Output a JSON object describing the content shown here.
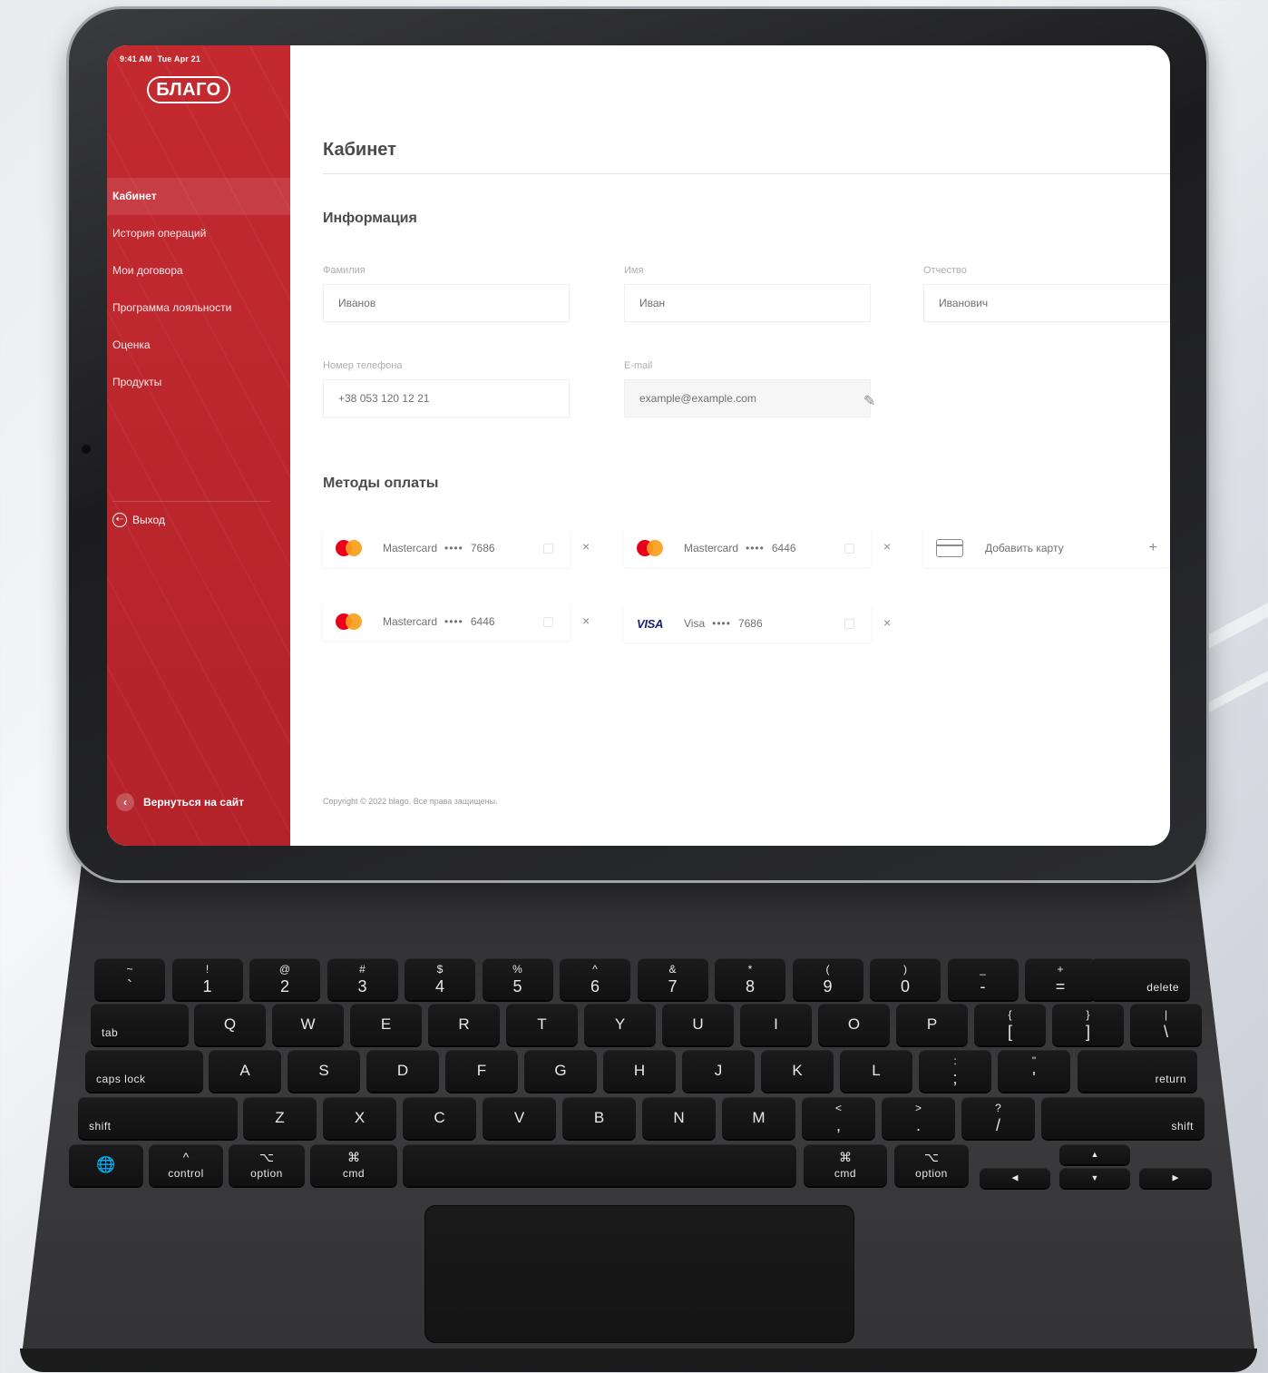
{
  "status_bar": {
    "time": "9:41 AM",
    "date": "Tue Apr 21"
  },
  "sidebar": {
    "logo": "БЛАГО",
    "items": [
      {
        "label": "Кабинет"
      },
      {
        "label": "История операций"
      },
      {
        "label": "Мои договора"
      },
      {
        "label": "Программа лояльности"
      },
      {
        "label": "Оценка"
      },
      {
        "label": "Продукты"
      }
    ],
    "logout_label": "Выход",
    "back_label": "Вернуться на сайт"
  },
  "main": {
    "title": "Кабинет",
    "info_title": "Информация",
    "fields": {
      "last_name": {
        "label": "Фамилия",
        "value": "Иванов"
      },
      "first_name": {
        "label": "Имя",
        "value": "Иван"
      },
      "patronymic": {
        "label": "Отчество",
        "value": "Иванович"
      },
      "phone": {
        "label": "Номер телефона",
        "value": "+38 053 120 12 21"
      },
      "email": {
        "label": "E-mail",
        "value": "example@example.com"
      }
    },
    "payment_title": "Методы оплаты",
    "cards": [
      {
        "brand": "Mastercard",
        "dots": "••••",
        "last4": "7686"
      },
      {
        "brand": "Mastercard",
        "dots": "••••",
        "last4": "6446"
      },
      {
        "brand": "Mastercard",
        "dots": "••••",
        "last4": "6446"
      },
      {
        "brand": "Visa",
        "logo": "VISA",
        "dots": "••••",
        "last4": "7686"
      }
    ],
    "add_card_label": "Добавить карту",
    "remove_symbol": "×",
    "add_symbol": "+",
    "copyright": "Copyright © 2022 blago. Все права защищены."
  },
  "keyboard": {
    "number_row": [
      {
        "top": "~",
        "bot": "`"
      },
      {
        "top": "!",
        "bot": "1"
      },
      {
        "top": "@",
        "bot": "2"
      },
      {
        "top": "#",
        "bot": "3"
      },
      {
        "top": "$",
        "bot": "4"
      },
      {
        "top": "%",
        "bot": "5"
      },
      {
        "top": "^",
        "bot": "6"
      },
      {
        "top": "&",
        "bot": "7"
      },
      {
        "top": "*",
        "bot": "8"
      },
      {
        "top": "(",
        "bot": "9"
      },
      {
        "top": ")",
        "bot": "0"
      },
      {
        "top": "_",
        "bot": "-"
      },
      {
        "top": "+",
        "bot": "="
      }
    ],
    "delete": "delete",
    "tab": "tab",
    "row_q": [
      "Q",
      "W",
      "E",
      "R",
      "T",
      "Y",
      "U",
      "I",
      "O",
      "P"
    ],
    "row_q_brackets": [
      {
        "top": "{",
        "bot": "["
      },
      {
        "top": "}",
        "bot": "]"
      },
      {
        "top": "|",
        "bot": "\\"
      }
    ],
    "caps": "caps lock",
    "row_a": [
      "A",
      "S",
      "D",
      "F",
      "G",
      "H",
      "J",
      "K",
      "L"
    ],
    "row_a_punct": [
      {
        "top": ":",
        "bot": ";"
      },
      {
        "top": "\"",
        "bot": "'"
      }
    ],
    "return": "return",
    "shift": "shift",
    "row_z": [
      "Z",
      "X",
      "C",
      "V",
      "B",
      "N",
      "M"
    ],
    "row_z_punct": [
      {
        "top": "<",
        "bot": ","
      },
      {
        "top": ">",
        "bot": "."
      },
      {
        "top": "?",
        "bot": "/"
      }
    ],
    "fn_globe": "🌐",
    "control": "control",
    "control_sym": "^",
    "option": "option",
    "option_sym": "⌥",
    "cmd": "cmd",
    "cmd_sym": "⌘",
    "arrows": {
      "left": "◀",
      "up": "▲",
      "down": "▼",
      "right": "▶"
    }
  }
}
